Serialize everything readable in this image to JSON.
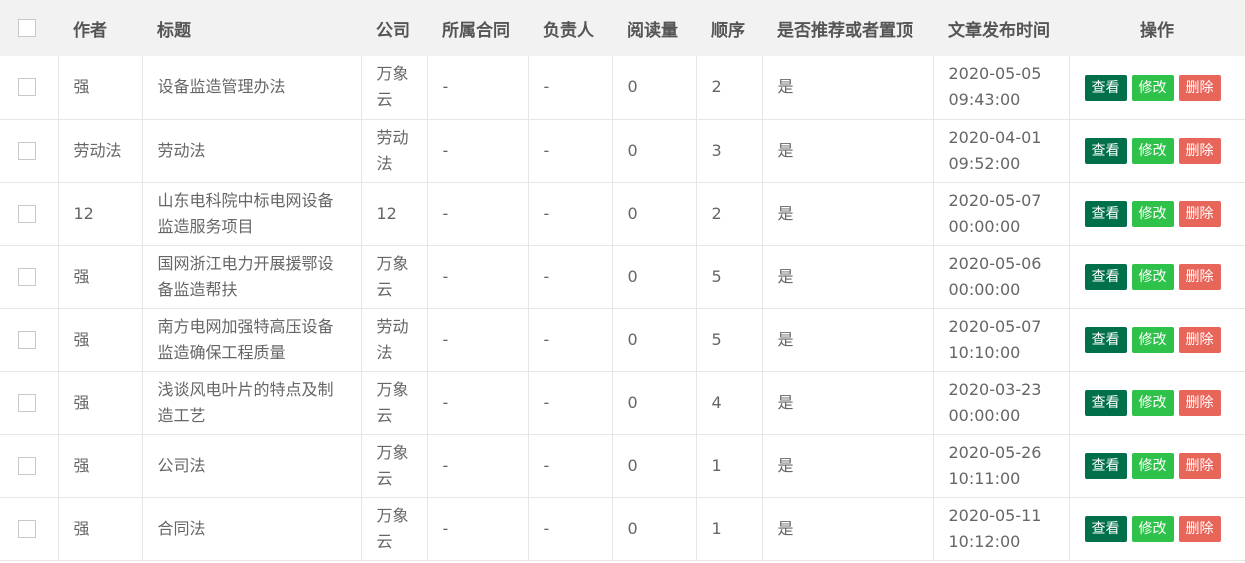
{
  "table": {
    "headers": {
      "author": "作者",
      "title": "标题",
      "company": "公司",
      "contract": "所属合同",
      "owner": "负责人",
      "reads": "阅读量",
      "order": "顺序",
      "recommend": "是否推荐或者置顶",
      "publish_time": "文章发布时间",
      "actions": "操作"
    },
    "actions": {
      "view": "查看",
      "edit": "修改",
      "delete": "删除"
    },
    "rows": [
      {
        "author": "强",
        "title": "设备监造管理办法",
        "company": "万象云",
        "contract": "-",
        "owner": "-",
        "reads": "0",
        "order": "2",
        "recommend": "是",
        "date": "2020-05-05",
        "time": "09:43:00"
      },
      {
        "author": "劳动法",
        "title": "劳动法",
        "company": "劳动法",
        "contract": "-",
        "owner": "-",
        "reads": "0",
        "order": "3",
        "recommend": "是",
        "date": "2020-04-01",
        "time": "09:52:00"
      },
      {
        "author": "12",
        "title": "山东电科院中标电网设备监造服务项目",
        "company": "12",
        "contract": "-",
        "owner": "-",
        "reads": "0",
        "order": "2",
        "recommend": "是",
        "date": "2020-05-07",
        "time": "00:00:00"
      },
      {
        "author": "强",
        "title": "国网浙江电力开展援鄂设备监造帮扶",
        "company": "万象云",
        "contract": "-",
        "owner": "-",
        "reads": "0",
        "order": "5",
        "recommend": "是",
        "date": "2020-05-06",
        "time": "00:00:00"
      },
      {
        "author": "强",
        "title": "南方电网加强特高压设备监造确保工程质量",
        "company": "劳动法",
        "contract": "-",
        "owner": "-",
        "reads": "0",
        "order": "5",
        "recommend": "是",
        "date": "2020-05-07",
        "time": "10:10:00"
      },
      {
        "author": "强",
        "title": "浅谈风电叶片的特点及制造工艺",
        "company": "万象云",
        "contract": "-",
        "owner": "-",
        "reads": "0",
        "order": "4",
        "recommend": "是",
        "date": "2020-03-23",
        "time": "00:00:00"
      },
      {
        "author": "强",
        "title": "公司法",
        "company": "万象云",
        "contract": "-",
        "owner": "-",
        "reads": "0",
        "order": "1",
        "recommend": "是",
        "date": "2020-05-26",
        "time": "10:11:00"
      },
      {
        "author": "强",
        "title": "合同法",
        "company": "万象云",
        "contract": "-",
        "owner": "-",
        "reads": "0",
        "order": "1",
        "recommend": "是",
        "date": "2020-05-11",
        "time": "10:12:00"
      }
    ]
  },
  "colors": {
    "header_bg": "#f2f2f2",
    "view_button": "#00704a",
    "edit_button": "#2fc24a",
    "delete_button": "#e8655a"
  }
}
